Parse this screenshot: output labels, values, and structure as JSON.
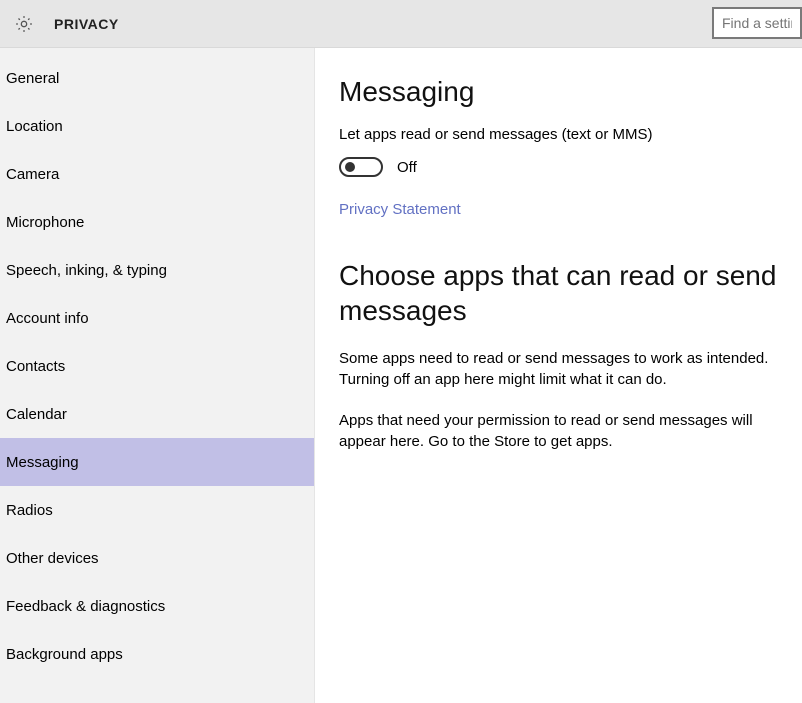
{
  "header": {
    "title": "PRIVACY",
    "search_placeholder": "Find a settin"
  },
  "sidebar": {
    "items": [
      {
        "label": "General",
        "selected": false
      },
      {
        "label": "Location",
        "selected": false
      },
      {
        "label": "Camera",
        "selected": false
      },
      {
        "label": "Microphone",
        "selected": false
      },
      {
        "label": "Speech, inking, & typing",
        "selected": false
      },
      {
        "label": "Account info",
        "selected": false
      },
      {
        "label": "Contacts",
        "selected": false
      },
      {
        "label": "Calendar",
        "selected": false
      },
      {
        "label": "Messaging",
        "selected": true
      },
      {
        "label": "Radios",
        "selected": false
      },
      {
        "label": "Other devices",
        "selected": false
      },
      {
        "label": "Feedback & diagnostics",
        "selected": false
      },
      {
        "label": "Background apps",
        "selected": false
      }
    ]
  },
  "main": {
    "heading": "Messaging",
    "description": "Let apps read or send messages (text or MMS)",
    "toggle_state": "Off",
    "privacy_link": "Privacy Statement",
    "section_heading": "Choose apps that can read or send messages",
    "para1": "Some apps need to read or send messages to work as intended. Turning off an app here might limit what it can do.",
    "para2": "Apps that need your permission to read or send messages will appear here. Go to the Store to get apps."
  }
}
